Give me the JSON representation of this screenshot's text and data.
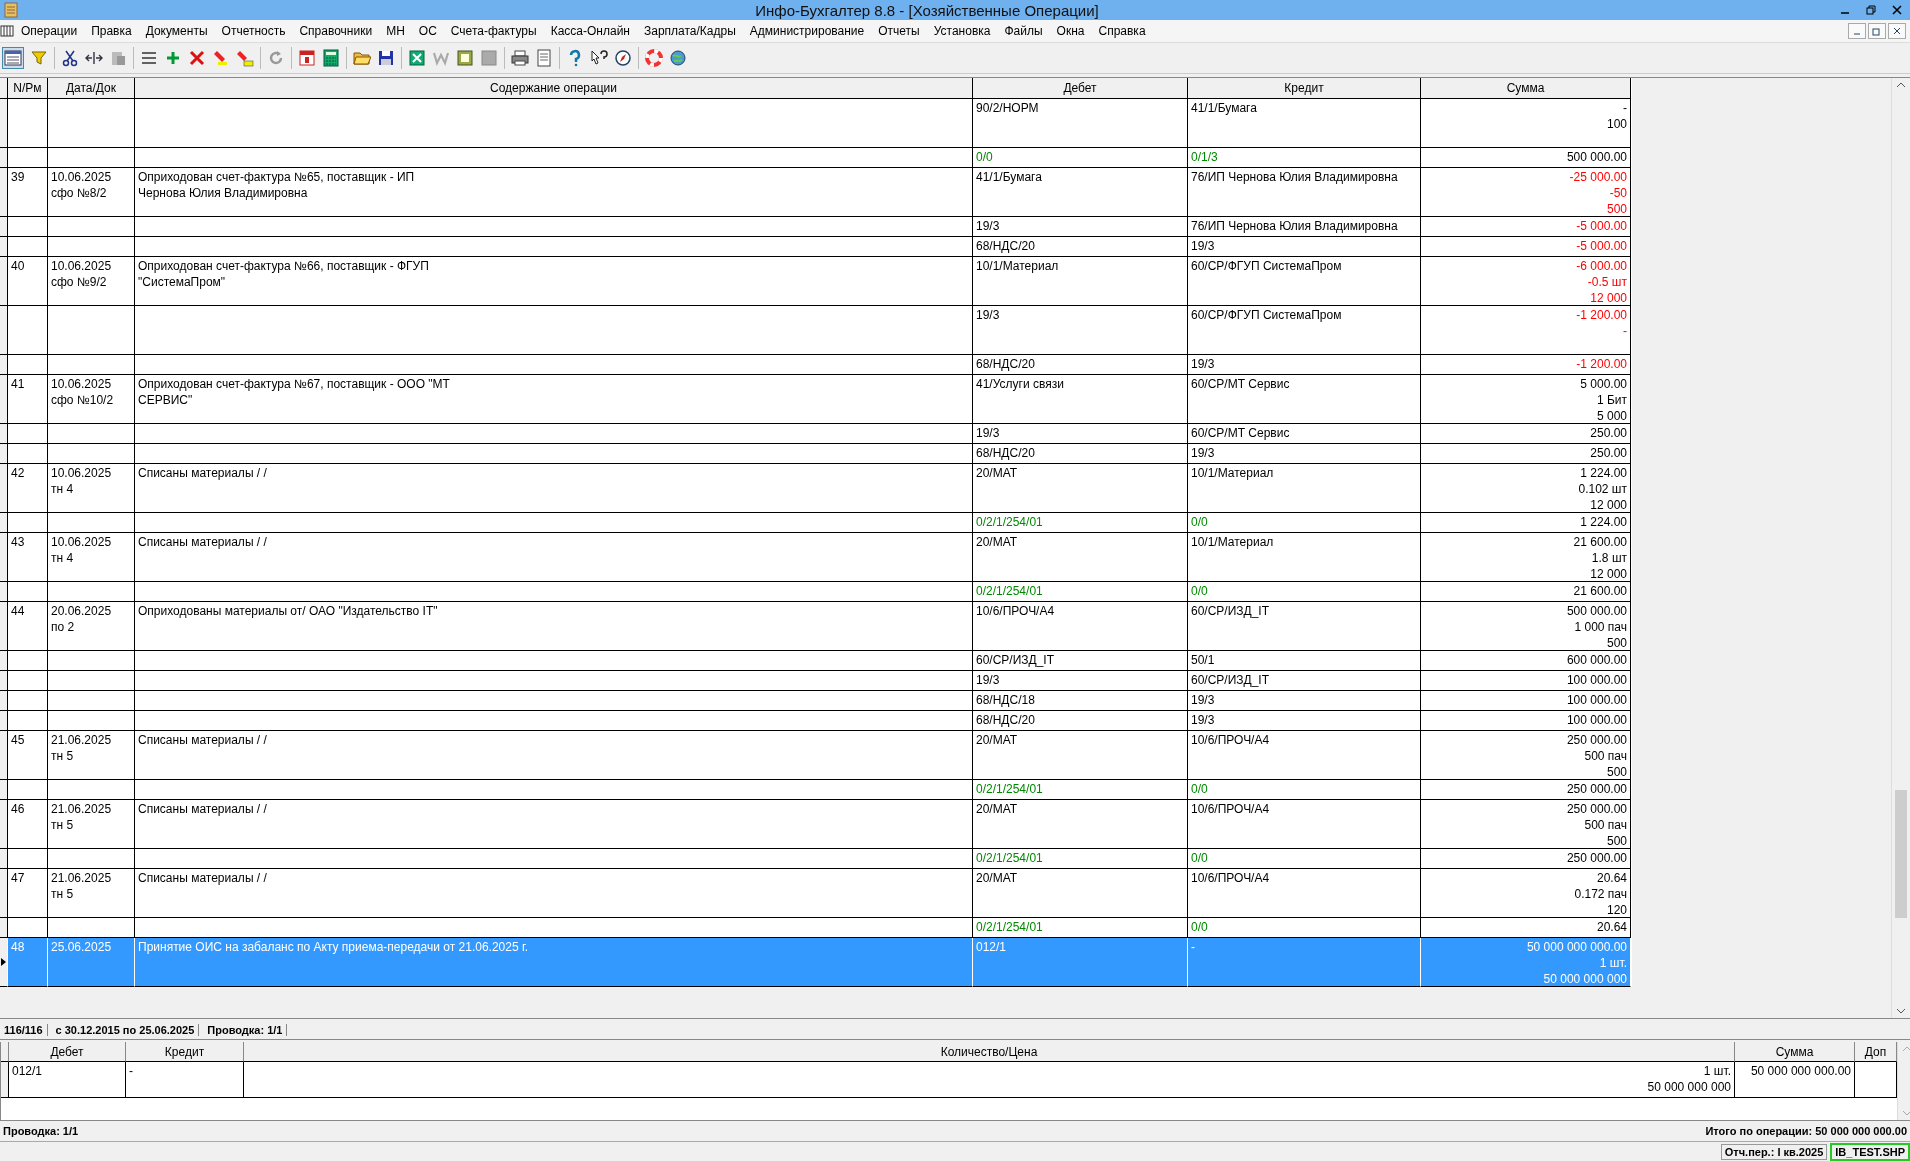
{
  "window": {
    "title": "Инфо-Бухгалтер 8.8 - [Хозяйственные Операции]"
  },
  "menu": [
    "Операции",
    "Правка",
    "Документы",
    "Отчетность",
    "Справочники",
    "МН",
    "ОС",
    "Счета-фактуры",
    "Касса-Онлайн",
    "Зарплата/Кадры",
    "Администрирование",
    "Отчеты",
    "Установка",
    "Файлы",
    "Окна",
    "Справка"
  ],
  "table": {
    "columns": [
      "N/Рм",
      "Дата/Док",
      "Содержание операции",
      "Дебет",
      "Кредит",
      "Сумма"
    ],
    "rows": [
      {
        "debit": "90/2/НОРМ",
        "credit": "41/1/Бумага",
        "sum": [
          "-",
          "100"
        ],
        "kind": "main",
        "storno": false,
        "selected": false
      },
      {
        "debit": "0/0",
        "credit": "0/1/3",
        "sum": [
          "500 000.00"
        ],
        "kind": "analytic",
        "storno": false,
        "selected": false
      },
      {
        "num": "39",
        "date": "10.06.2025",
        "doc": "сфо №8/2",
        "content": "Оприходован счет-фактура №65, поставщик - ИП\nЧернова Юлия Владимировна",
        "debit": "41/1/Бумага",
        "credit": "76/ИП Чернова Юлия Владимировна",
        "sum": [
          "-25 000.00",
          "-50",
          "500"
        ],
        "kind": "main",
        "storno": true,
        "selected": false
      },
      {
        "debit": "19/3",
        "credit": "76/ИП Чернова Юлия Владимировна",
        "sum": [
          "-5 000.00"
        ],
        "kind": "main",
        "storno": true,
        "selected": false
      },
      {
        "debit": "68/НДС/20",
        "credit": "19/3",
        "sum": [
          "-5 000.00"
        ],
        "kind": "main",
        "storno": true,
        "selected": false
      },
      {
        "num": "40",
        "date": "10.06.2025",
        "doc": "сфо №9/2",
        "content": "Оприходован счет-фактура №66, поставщик - ФГУП\n\"СистемаПром\"",
        "debit": "10/1/Материал",
        "credit": "60/СР/ФГУП СистемаПром",
        "sum": [
          "-6 000.00",
          "-0.5 шт",
          "12 000"
        ],
        "kind": "main",
        "storno": true,
        "selected": false
      },
      {
        "debit": "19/3",
        "credit": "60/СР/ФГУП СистемаПром",
        "sum": [
          "-1 200.00",
          "-"
        ],
        "kind": "main",
        "storno": true,
        "selected": false
      },
      {
        "debit": "68/НДС/20",
        "credit": "19/3",
        "sum": [
          "-1 200.00"
        ],
        "kind": "main",
        "storno": true,
        "selected": false
      },
      {
        "num": "41",
        "date": "10.06.2025",
        "doc": "сфо №10/2",
        "content": "Оприходован счет-фактура №67, поставщик - ООО \"МТ\nСЕРВИС\"",
        "debit": "41/Услуги связи",
        "credit": "60/СР/МТ Сервис",
        "sum": [
          "5 000.00",
          "1 Бит",
          "5 000"
        ],
        "kind": "main",
        "storno": false,
        "selected": false
      },
      {
        "debit": "19/3",
        "credit": "60/СР/МТ Сервис",
        "sum": [
          "250.00"
        ],
        "kind": "main",
        "storno": false,
        "selected": false
      },
      {
        "debit": "68/НДС/20",
        "credit": "19/3",
        "sum": [
          "250.00"
        ],
        "kind": "main",
        "storno": false,
        "selected": false
      },
      {
        "num": "42",
        "date": "10.06.2025",
        "doc": "тн 4",
        "content": "Списаны материалы / /",
        "debit": "20/МАТ",
        "credit": "10/1/Материал",
        "sum": [
          "1 224.00",
          "0.102 шт",
          "12 000"
        ],
        "kind": "main",
        "storno": false,
        "selected": false
      },
      {
        "debit": "0/2/1/254/01",
        "credit": "0/0",
        "sum": [
          "1 224.00"
        ],
        "kind": "analytic",
        "storno": false,
        "selected": false
      },
      {
        "num": "43",
        "date": "10.06.2025",
        "doc": "тн 4",
        "content": "Списаны материалы / /",
        "debit": "20/МАТ",
        "credit": "10/1/Материал",
        "sum": [
          "21 600.00",
          "1.8 шт",
          "12 000"
        ],
        "kind": "main",
        "storno": false,
        "selected": false
      },
      {
        "debit": "0/2/1/254/01",
        "credit": "0/0",
        "sum": [
          "21 600.00"
        ],
        "kind": "analytic",
        "storno": false,
        "selected": false
      },
      {
        "num": "44",
        "date": "20.06.2025",
        "doc": "по 2",
        "content": "Оприходованы материалы от/ ОАО \"Издательство IT\"",
        "debit": "10/6/ПРОЧ/А4",
        "credit": "60/СР/ИЗД_IT",
        "sum": [
          "500 000.00",
          "1 000 пач",
          "500"
        ],
        "kind": "main",
        "storno": false,
        "selected": false
      },
      {
        "debit": "60/СР/ИЗД_IT",
        "credit": "50/1",
        "sum": [
          "600 000.00"
        ],
        "kind": "main",
        "storno": false,
        "selected": false
      },
      {
        "debit": "19/3",
        "credit": "60/СР/ИЗД_IT",
        "sum": [
          "100 000.00"
        ],
        "kind": "main",
        "storno": false,
        "selected": false
      },
      {
        "debit": "68/НДС/18",
        "credit": "19/3",
        "sum": [
          "100 000.00"
        ],
        "kind": "main",
        "storno": false,
        "selected": false
      },
      {
        "debit": "68/НДС/20",
        "credit": "19/3",
        "sum": [
          "100 000.00"
        ],
        "kind": "main",
        "storno": false,
        "selected": false
      },
      {
        "num": "45",
        "date": "21.06.2025",
        "doc": "тн 5",
        "content": "Списаны материалы / /",
        "debit": "20/МАТ",
        "credit": "10/6/ПРОЧ/А4",
        "sum": [
          "250 000.00",
          "500 пач",
          "500"
        ],
        "kind": "main",
        "storno": false,
        "selected": false
      },
      {
        "debit": "0/2/1/254/01",
        "credit": "0/0",
        "sum": [
          "250 000.00"
        ],
        "kind": "analytic",
        "storno": false,
        "selected": false
      },
      {
        "num": "46",
        "date": "21.06.2025",
        "doc": "тн 5",
        "content": "Списаны материалы / /",
        "debit": "20/МАТ",
        "credit": "10/6/ПРОЧ/А4",
        "sum": [
          "250 000.00",
          "500 пач",
          "500"
        ],
        "kind": "main",
        "storno": false,
        "selected": false
      },
      {
        "debit": "0/2/1/254/01",
        "credit": "0/0",
        "sum": [
          "250 000.00"
        ],
        "kind": "analytic",
        "storno": false,
        "selected": false
      },
      {
        "num": "47",
        "date": "21.06.2025",
        "doc": "тн 5",
        "content": "Списаны материалы / /",
        "debit": "20/МАТ",
        "credit": "10/6/ПРОЧ/А4",
        "sum": [
          "20.64",
          "0.172 пач",
          "120"
        ],
        "kind": "main",
        "storno": false,
        "selected": false
      },
      {
        "debit": "0/2/1/254/01",
        "credit": "0/0",
        "sum": [
          "20.64"
        ],
        "kind": "analytic",
        "storno": false,
        "selected": false
      },
      {
        "num": "48",
        "date": "25.06.2025",
        "content": "Принятие ОИС на забаланс по Акту приема-передачи от 21.06.2025 г.",
        "debit": "012/1",
        "credit": "-",
        "sum": [
          "50 000 000 000.00",
          "1 шт.",
          "50 000 000 000"
        ],
        "kind": "main",
        "storno": false,
        "selected": true
      }
    ]
  },
  "info_strip": {
    "count": "116/116",
    "period": "с 30.12.2015 по 25.06.2025",
    "posting": "Проводка: 1/1"
  },
  "detail": {
    "columns": [
      "Дебет",
      "Кредит",
      "Количество/Цена",
      "Сумма",
      "Доп"
    ],
    "rows": [
      {
        "debit": "012/1",
        "credit": "-",
        "quantity": [
          "1 шт.",
          "50 000 000 000"
        ],
        "sum": "50 000 000 000.00"
      }
    ]
  },
  "footer": {
    "posting": "Проводка: 1/1",
    "total": "Итого по операции: 50 000 000 000.00"
  },
  "status_bar": {
    "period": "Отч.пер.: I кв.2025",
    "file": "IB_TEST.SHP"
  }
}
